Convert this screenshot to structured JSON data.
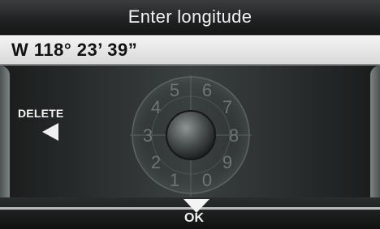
{
  "title": "Enter longitude",
  "entry": {
    "value": "W 118° 23’ 39”"
  },
  "delete_button": {
    "label": "DELETE",
    "icon": "left-triangle-icon"
  },
  "ok_button": {
    "label": "OK",
    "icon": "down-triangle-icon"
  },
  "dial": {
    "digits": [
      "5",
      "6",
      "4",
      "7",
      "3",
      "8",
      "2",
      "9",
      "1",
      "0"
    ],
    "selected": ""
  },
  "colors": {
    "title_bg": "#1f2122",
    "entry_bg": "#e6e6e6",
    "panel_bg": "#2e3232",
    "text": "#f2f2f2"
  }
}
